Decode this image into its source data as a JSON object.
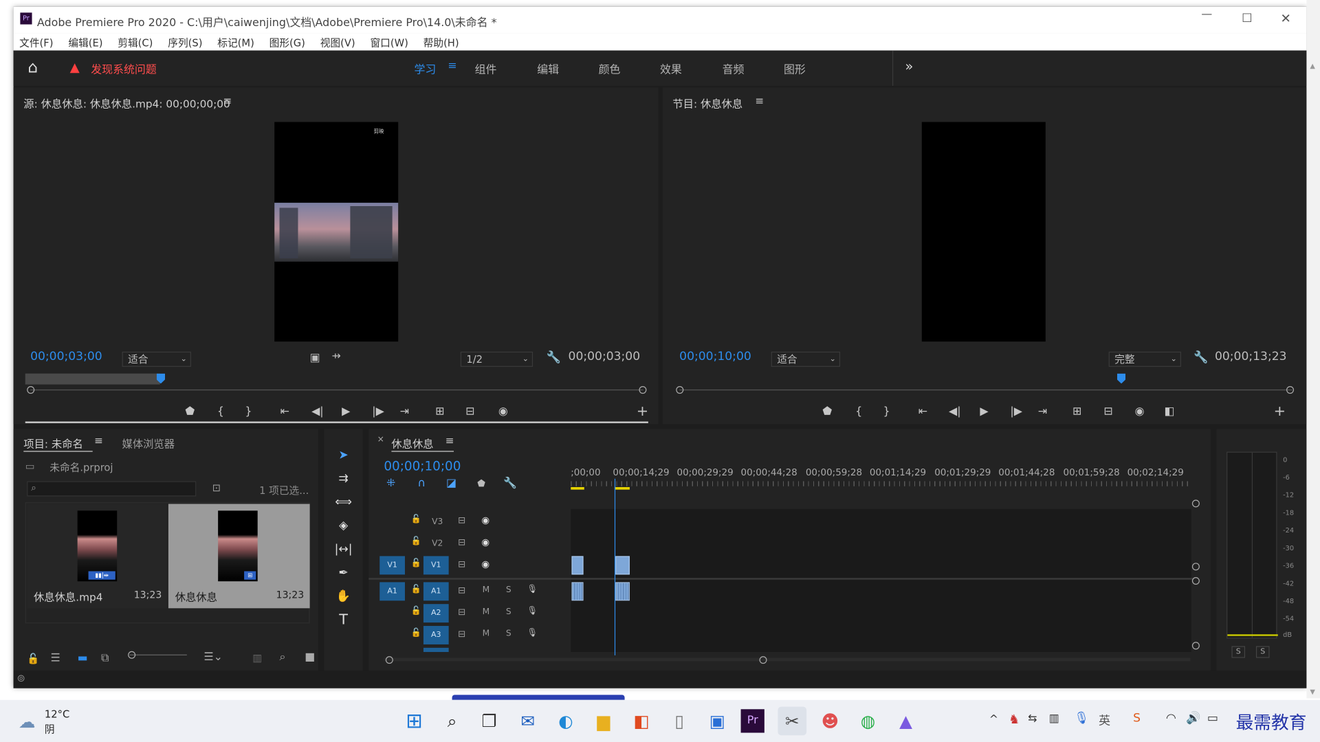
{
  "title": "Adobe Premiere Pro 2020 - C:\\用户\\caiwenjing\\文档\\Adobe\\Premiere Pro\\14.0\\未命名 *",
  "app_icon": "Pr",
  "menu": [
    "文件(F)",
    "编辑(E)",
    "剪辑(C)",
    "序列(S)",
    "标记(M)",
    "图形(G)",
    "视图(V)",
    "窗口(W)",
    "帮助(H)"
  ],
  "workspace": {
    "warning": "发现系统问题",
    "tabs": [
      "学习",
      "组件",
      "编辑",
      "颜色",
      "效果",
      "音频",
      "图形"
    ],
    "more": "»"
  },
  "source": {
    "title": "源: 休息休息: 休息休息.mp4: 00;00;00;00",
    "timecode": "00;00;03;00",
    "fit": "适合",
    "quality": "1/2",
    "duration": "00;00;03;00",
    "watermark": "剪映"
  },
  "program": {
    "title": "节目: 休息休息",
    "timecode": "00;00;10;00",
    "fit": "适合",
    "quality": "完整",
    "duration": "00;00;13;23"
  },
  "project": {
    "tab1": "项目: 未命名",
    "tab2": "媒体浏览器",
    "file": "未命名.prproj",
    "search_placeholder": "",
    "selected": "1 项已选...",
    "items": [
      {
        "name": "休息休息.mp4",
        "dur": "13;23"
      },
      {
        "name": "休息休息",
        "dur": "13;23"
      }
    ]
  },
  "timeline": {
    "tab": "休息休息",
    "timecode": "00;00;10;00",
    "ruler": [
      ";00;00",
      "00;00;14;29",
      "00;00;29;29",
      "00;00;44;28",
      "00;00;59;28",
      "00;01;14;29",
      "00;01;29;29",
      "00;01;44;28",
      "00;01;59;28",
      "00;02;14;29"
    ],
    "video_tracks": [
      "V3",
      "V2",
      "V1"
    ],
    "audio_tracks": [
      "A1",
      "A2",
      "A3"
    ],
    "src_v": "V1",
    "src_a": "A1",
    "m": "M",
    "s": "S"
  },
  "meter": {
    "scale": [
      "0",
      "-6",
      "-12",
      "-18",
      "-24",
      "-30",
      "-36",
      "-42",
      "-48",
      "-54",
      "dB"
    ],
    "solo": [
      "S",
      "S"
    ]
  },
  "taskbar": {
    "temp": "12°C",
    "weather": "阴",
    "brand": "最需教育"
  }
}
